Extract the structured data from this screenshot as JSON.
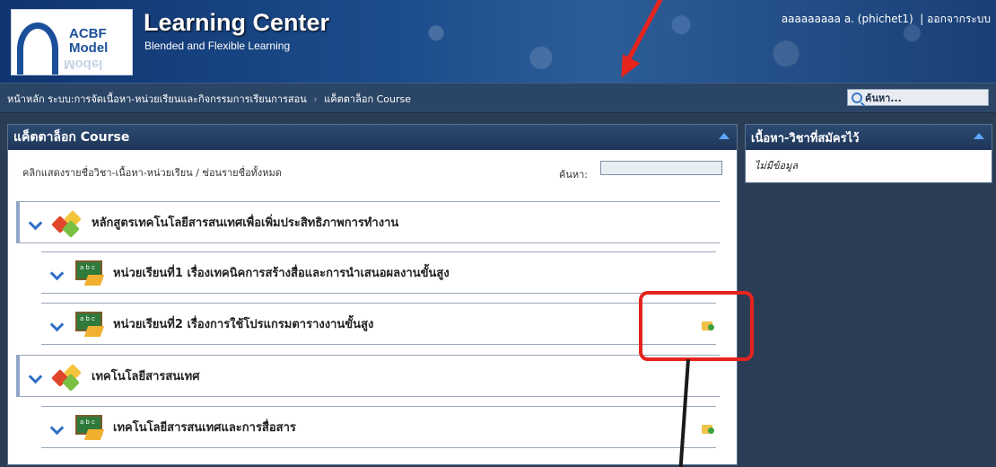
{
  "header": {
    "logo": {
      "line1": "ACBF",
      "line2": "Model",
      "line3": "Model"
    },
    "title": "Learning Center",
    "subtitle": "Blended and Flexible Learning",
    "user": "aaaaaaaaa a. (phichet1)",
    "logout": "ออกจากระบบ"
  },
  "nav": {
    "breadcrumb": [
      "หน้าหลัก",
      "ระบบ:การจัดเนื้อหา-หน่วยเรียนและกิจกรรมการเรียนการสอน",
      "แค็ตตาล็อก Course"
    ],
    "search_label": "ค้นหา..."
  },
  "catalog": {
    "title": "แค็ตตาล็อก Course",
    "toggle_link": "คลิกแสดงรายชื่อวิชา-เนื้อหา-หน่วยเรียน / ซ่อนรายชื่อทั้งหมด",
    "search_label": "ค้นหา:",
    "search_value": "",
    "items": [
      {
        "label": "หลักสูตรเทคโนโลยีสารสนเทศเพื่อเพิ่มประสิทธิภาพการทำงาน"
      },
      {
        "label": "หน่วยเรียนที่1 เรื่องเทคนิคการสร้างสื่อและการนำเสนอผลงานขั้นสูง"
      },
      {
        "label": "หน่วยเรียนที่2 เรื่องการใช้โปรแกรมตารางงานขั้นสูง"
      },
      {
        "label": "เทคโนโลยีสารสนเทศ"
      },
      {
        "label": "เทคโนโลยีสารสนเทศและการสื่อสาร"
      }
    ]
  },
  "side": {
    "title": "เนื้อหา-วิชาที่สมัครไว้",
    "empty": "ไม่มีข้อมูล"
  },
  "icons": {
    "board_text": "a b c"
  },
  "colors": {
    "annotation": "#e5241e",
    "accent": "#2f70c8",
    "header": "#1d4c8c"
  }
}
